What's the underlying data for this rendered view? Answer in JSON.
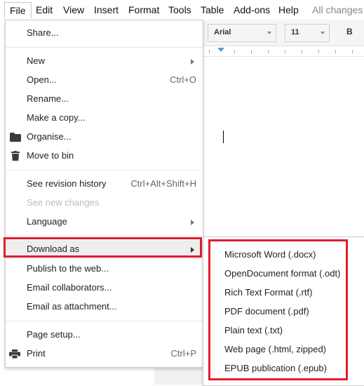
{
  "menubar": {
    "file": "File",
    "edit": "Edit",
    "view": "View",
    "insert": "Insert",
    "format": "Format",
    "tools": "Tools",
    "table": "Table",
    "addons": "Add-ons",
    "help": "Help",
    "status": "All changes s"
  },
  "toolbar": {
    "font": "Arial",
    "size": "11",
    "bold_label": "B"
  },
  "file_menu": {
    "share": "Share...",
    "new": "New",
    "open": "Open...",
    "open_shortcut": "Ctrl+O",
    "rename": "Rename...",
    "make_copy": "Make a copy...",
    "organise": "Organise...",
    "move_to_bin": "Move to bin",
    "revision_history": "See revision history",
    "revision_shortcut": "Ctrl+Alt+Shift+H",
    "new_changes": "See new changes",
    "language": "Language",
    "download_as": "Download as",
    "publish": "Publish to the web...",
    "email_collaborators": "Email collaborators...",
    "email_attachment": "Email as attachment...",
    "page_setup": "Page setup...",
    "print": "Print",
    "print_shortcut": "Ctrl+P"
  },
  "download_submenu": {
    "word": "Microsoft Word (.docx)",
    "odt": "OpenDocument format (.odt)",
    "rtf": "Rich Text Format (.rtf)",
    "pdf": "PDF document (.pdf)",
    "txt": "Plain text (.txt)",
    "html": "Web page (.html, zipped)",
    "epub": "EPUB publication (.epub)"
  },
  "colors": {
    "highlight": "#e11d2e",
    "menu_active": "#eeeeee",
    "disabled_text": "#bbbbbb"
  }
}
